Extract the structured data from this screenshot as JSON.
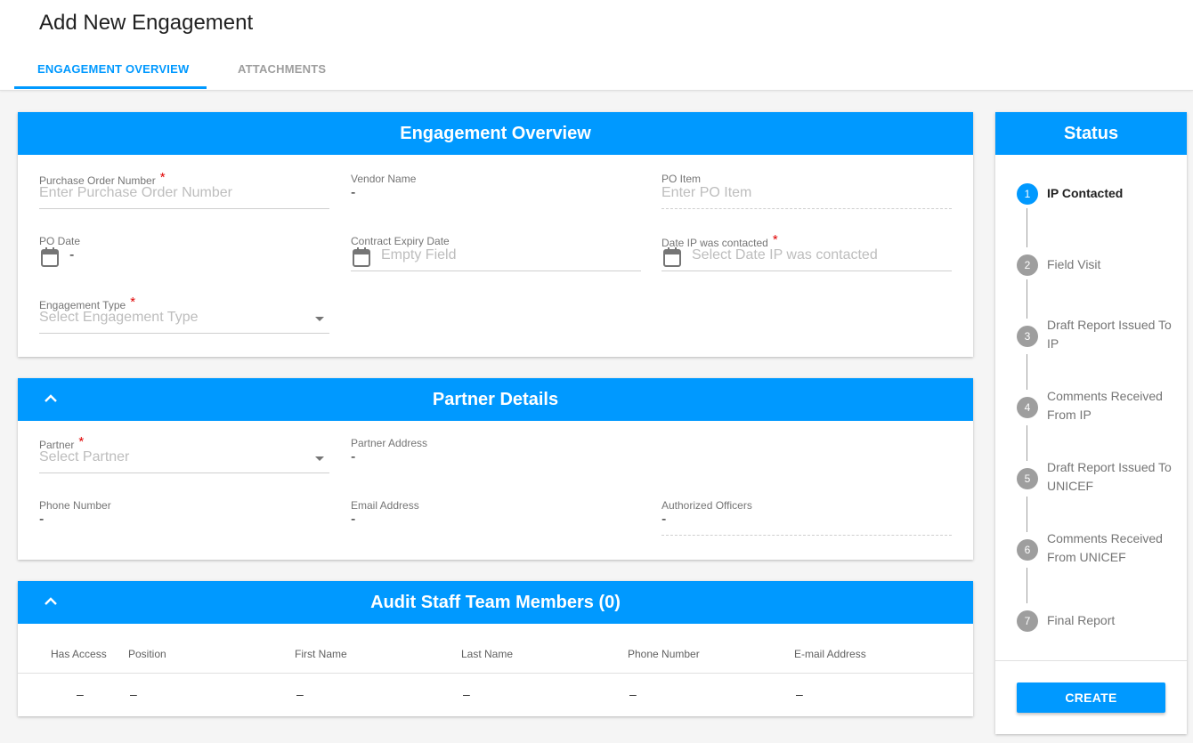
{
  "page": {
    "title": "Add New Engagement"
  },
  "tabs": [
    {
      "label": "ENGAGEMENT OVERVIEW",
      "active": true
    },
    {
      "label": "ATTACHMENTS",
      "active": false
    }
  ],
  "engagement_overview": {
    "title": "Engagement Overview",
    "purchase_order_number": {
      "label": "Purchase Order Number",
      "placeholder": "Enter Purchase Order Number",
      "required": "*"
    },
    "vendor_name": {
      "label": "Vendor Name",
      "value": "-"
    },
    "po_item": {
      "label": "PO Item",
      "placeholder": "Enter PO Item"
    },
    "po_date": {
      "label": "PO Date",
      "value": "-"
    },
    "contract_expiry_date": {
      "label": "Contract Expiry Date",
      "placeholder": "Empty Field"
    },
    "date_ip_contacted": {
      "label": "Date IP was contacted",
      "placeholder": "Select Date IP was contacted",
      "required": "*"
    },
    "engagement_type": {
      "label": "Engagement Type",
      "placeholder": "Select Engagement Type",
      "required": "*"
    }
  },
  "partner_details": {
    "title": "Partner Details",
    "partner": {
      "label": "Partner",
      "placeholder": "Select Partner",
      "required": "*"
    },
    "partner_address": {
      "label": "Partner Address",
      "value": "-"
    },
    "phone_number": {
      "label": "Phone Number",
      "value": "-"
    },
    "email_address": {
      "label": "Email Address",
      "value": "-"
    },
    "authorized_officers": {
      "label": "Authorized Officers",
      "value": "-"
    }
  },
  "audit_staff": {
    "title": "Audit Staff Team Members (0)",
    "columns": [
      "Has Access",
      "Position",
      "First Name",
      "Last Name",
      "Phone Number",
      "E-mail Address"
    ],
    "row": [
      "–",
      "–",
      "–",
      "–",
      "–",
      "–"
    ]
  },
  "status": {
    "title": "Status",
    "steps": [
      {
        "number": "1",
        "label": "IP Contacted",
        "active": true
      },
      {
        "number": "2",
        "label": "Field Visit"
      },
      {
        "number": "3",
        "label": "Draft Report Issued To IP"
      },
      {
        "number": "4",
        "label": "Comments Received From IP"
      },
      {
        "number": "5",
        "label": "Draft Report Issued To UNICEF"
      },
      {
        "number": "6",
        "label": "Comments Received From UNICEF"
      },
      {
        "number": "7",
        "label": "Final Report"
      }
    ],
    "create_label": "CREATE"
  },
  "colors": {
    "accent": "#0099ff",
    "required": "#e00000",
    "step_inactive": "#9e9e9e"
  },
  "icons": [
    "calendar-icon",
    "chevron-up-icon",
    "dropdown-caret-icon"
  ]
}
